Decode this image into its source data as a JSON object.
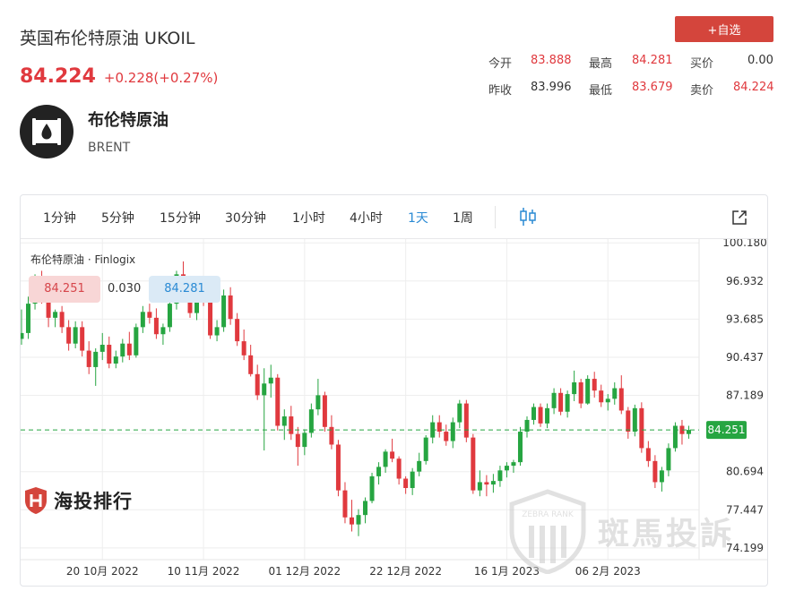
{
  "header": {
    "title": "英国布伦特原油 UKOIL",
    "price": "84.224",
    "change": "+0.228(+0.27%)",
    "add_watchlist": "+自选"
  },
  "stats": {
    "open_label": "今开",
    "open": "83.888",
    "high_label": "最高",
    "high": "84.281",
    "bid_label": "买价",
    "bid": "0.00",
    "prev_close_label": "昨收",
    "prev_close": "83.996",
    "low_label": "最低",
    "low": "83.679",
    "ask_label": "卖价",
    "ask": "84.224"
  },
  "instrument": {
    "name_cn": "布伦特原油",
    "name_en": "BRENT"
  },
  "toolbar": {
    "timeframes": [
      "1分钟",
      "5分钟",
      "15分钟",
      "30分钟",
      "1小时",
      "4小时",
      "1天",
      "1周"
    ],
    "active": "1天"
  },
  "legend": {
    "title": "布伦特原油 · Finlogix",
    "sell": "84.251",
    "spread": "0.030",
    "buy": "84.281"
  },
  "watermarks": {
    "left": "海投排行",
    "right": "斑馬投訴",
    "seal": "ZEBRA RANK"
  },
  "colors": {
    "up": "#26a541",
    "down": "#e0393e",
    "accent": "#2a8ad4",
    "button": "#d4453c"
  },
  "chart_data": {
    "type": "candlestick",
    "title": "布伦特原油 · Finlogix",
    "y_ticks": [
      100.18,
      96.932,
      93.685,
      90.437,
      87.189,
      83.942,
      80.694,
      77.447,
      74.199
    ],
    "y_tick_labels": [
      "100.180",
      "96.932",
      "93.685",
      "90.437",
      "87.189",
      "83.942",
      "80.694",
      "77.447",
      "74.199"
    ],
    "ylim": [
      73.2,
      100.5
    ],
    "x_labels": [
      "20 10月 2022",
      "10 11月 2022",
      "01 12月 2022",
      "22 12月 2022",
      "16 1月 2023",
      "06 2月 2023"
    ],
    "x_label_index": [
      12,
      27,
      42,
      57,
      72,
      87
    ],
    "last_price": 84.251,
    "candles": [
      [
        92,
        94.5,
        91.5,
        92.5
      ],
      [
        92.5,
        95.6,
        92,
        95
      ],
      [
        95,
        97.5,
        94.5,
        97
      ],
      [
        97,
        97.8,
        95,
        95.6
      ],
      [
        95.6,
        96,
        93,
        93.8
      ],
      [
        93.8,
        94.5,
        93,
        94.3
      ],
      [
        94.3,
        94.8,
        92.5,
        93
      ],
      [
        93,
        93.6,
        91,
        91.6
      ],
      [
        91.6,
        93.5,
        91.2,
        93
      ],
      [
        93,
        93.5,
        90.5,
        91
      ],
      [
        91,
        91.8,
        89,
        89.6
      ],
      [
        89.6,
        91.2,
        88,
        90.9
      ],
      [
        90.9,
        92.5,
        90.2,
        91.5
      ],
      [
        91.5,
        92.2,
        89.5,
        89.9
      ],
      [
        89.9,
        91,
        89.5,
        90.5
      ],
      [
        90.5,
        92,
        90,
        91.6
      ],
      [
        91.6,
        92.6,
        90.2,
        90.6
      ],
      [
        90.6,
        93.3,
        90.4,
        93
      ],
      [
        93,
        94.8,
        92.5,
        94.3
      ],
      [
        94.3,
        95,
        93.3,
        93.8
      ],
      [
        93.8,
        94.6,
        92,
        92.4
      ],
      [
        92.4,
        93.3,
        91.5,
        93
      ],
      [
        93,
        95.4,
        92.6,
        95
      ],
      [
        95,
        97.8,
        94.5,
        97.5
      ],
      [
        97.5,
        98.6,
        95.5,
        95.8
      ],
      [
        95.8,
        96.6,
        93.8,
        94.2
      ],
      [
        94.2,
        96,
        93.6,
        95.5
      ],
      [
        95.5,
        96.2,
        94.8,
        95.2
      ],
      [
        95.2,
        95.5,
        92,
        92.3
      ],
      [
        92.3,
        93.6,
        91.8,
        93
      ],
      [
        93,
        96.2,
        92.6,
        95.7
      ],
      [
        95.7,
        96.4,
        93.2,
        93.7
      ],
      [
        93.7,
        94.2,
        91.4,
        91.8
      ],
      [
        91.8,
        92.8,
        90.2,
        90.6
      ],
      [
        90.6,
        91.5,
        88.8,
        89
      ],
      [
        89,
        89.8,
        86.8,
        87.2
      ],
      [
        87.2,
        89.5,
        82.5,
        88.2
      ],
      [
        88.2,
        89.8,
        87,
        88.7
      ],
      [
        88.7,
        89,
        84.2,
        84.6
      ],
      [
        84.6,
        86,
        83.4,
        85.4
      ],
      [
        85.4,
        86.3,
        83.4,
        83.9
      ],
      [
        83.9,
        84.5,
        81.2,
        82.8
      ],
      [
        82.8,
        84.3,
        82.1,
        84
      ],
      [
        84,
        86.5,
        83.6,
        86
      ],
      [
        86,
        88.6,
        85.5,
        87.2
      ],
      [
        87.2,
        87.5,
        84.1,
        84.5
      ],
      [
        84.5,
        85.5,
        82.6,
        83
      ],
      [
        83,
        83.4,
        78.6,
        79.1
      ],
      [
        79.1,
        79.8,
        76.3,
        76.8
      ],
      [
        76.8,
        78.3,
        75.6,
        76.2
      ],
      [
        76.2,
        77.5,
        75.2,
        77
      ],
      [
        77,
        78.5,
        76.3,
        78.2
      ],
      [
        78.2,
        80.6,
        78,
        80.3
      ],
      [
        80.3,
        81.5,
        79.6,
        81.1
      ],
      [
        81.1,
        82.6,
        80.6,
        82.4
      ],
      [
        82.4,
        83.5,
        81.5,
        81.8
      ],
      [
        81.8,
        82,
        79.6,
        80.1
      ],
      [
        80.1,
        80.3,
        78.8,
        79.3
      ],
      [
        79.3,
        81,
        78.7,
        80.7
      ],
      [
        80.7,
        82.3,
        80.3,
        81.6
      ],
      [
        81.6,
        83.8,
        81.3,
        83.6
      ],
      [
        83.6,
        85.5,
        83.1,
        84.9
      ],
      [
        84.9,
        85.5,
        83.6,
        84.1
      ],
      [
        84.1,
        84.7,
        82.9,
        83.3
      ],
      [
        83.3,
        85.3,
        82.7,
        84.9
      ],
      [
        84.9,
        86.8,
        84.4,
        86.5
      ],
      [
        86.5,
        86.8,
        83.2,
        83.6
      ],
      [
        83.6,
        83.9,
        78.8,
        79.1
      ],
      [
        79.1,
        80.8,
        78.6,
        79.8
      ],
      [
        79.8,
        80.4,
        78.6,
        79.6
      ],
      [
        79.6,
        80.5,
        78.9,
        79.9
      ],
      [
        79.9,
        81.2,
        79.4,
        80.8
      ],
      [
        80.8,
        81.5,
        80.2,
        81.2
      ],
      [
        81.2,
        81.7,
        80.6,
        81.5
      ],
      [
        81.5,
        84.5,
        81.2,
        84.1
      ],
      [
        84.1,
        85.4,
        83.6,
        85.1
      ],
      [
        85.1,
        86.5,
        84.7,
        86.2
      ],
      [
        86.2,
        86.5,
        84.5,
        84.8
      ],
      [
        84.8,
        86.5,
        84.4,
        86.1
      ],
      [
        86.1,
        87.8,
        85.6,
        87.4
      ],
      [
        87.4,
        87.8,
        85.5,
        85.8
      ],
      [
        85.8,
        87.6,
        85.3,
        87.3
      ],
      [
        87.3,
        89.3,
        86.7,
        88.3
      ],
      [
        88.3,
        88.6,
        86.1,
        86.5
      ],
      [
        86.5,
        88.9,
        86.4,
        88.6
      ],
      [
        88.6,
        89.2,
        87,
        87.6
      ],
      [
        87.6,
        88.1,
        86.2,
        86.6
      ],
      [
        86.6,
        87.3,
        85.9,
        86.9
      ],
      [
        86.9,
        88.3,
        86.4,
        87.8
      ],
      [
        87.8,
        88.9,
        85.6,
        85.9
      ],
      [
        85.9,
        86.2,
        83.5,
        84.1
      ],
      [
        84.1,
        86.4,
        83.7,
        86.1
      ],
      [
        86.1,
        86.6,
        82.3,
        82.7
      ],
      [
        82.7,
        83.3,
        81.1,
        81.6
      ],
      [
        81.6,
        82.1,
        79.3,
        79.8
      ],
      [
        79.8,
        81.1,
        79,
        80.8
      ],
      [
        80.8,
        83.1,
        80.3,
        82.7
      ],
      [
        82.7,
        84.9,
        82.4,
        84.6
      ],
      [
        84.6,
        85.1,
        83,
        83.9
      ],
      [
        83.9,
        84.6,
        83.5,
        84.25
      ]
    ]
  }
}
